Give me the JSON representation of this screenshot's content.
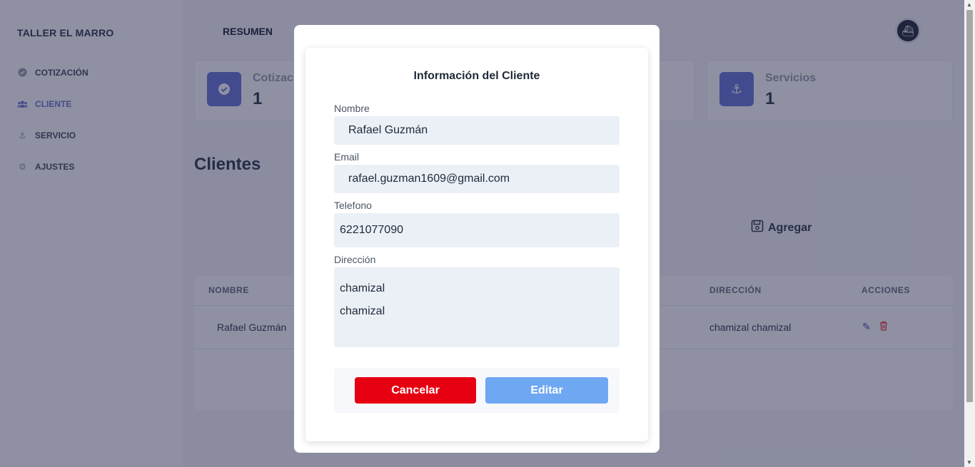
{
  "sidebar": {
    "brand": "TALLER EL MARRO",
    "items": [
      {
        "label": "COTIZACIÓN",
        "icon": "check-circle-icon",
        "active": false
      },
      {
        "label": "CLIENTE",
        "icon": "users-icon",
        "active": true
      },
      {
        "label": "SERVICIO",
        "icon": "anchor-icon",
        "active": false
      },
      {
        "label": "AJUSTES",
        "icon": "gear-icon",
        "active": false
      }
    ]
  },
  "header": {
    "title": "RESUMEN"
  },
  "stats": [
    {
      "label": "Cotizaciones",
      "value": "1",
      "icon": "check-circle-icon"
    },
    {
      "label": "Servicios",
      "value": "1",
      "icon": "anchor-icon"
    }
  ],
  "section": {
    "title": "Clientes",
    "add_label": "Agregar"
  },
  "table": {
    "headers": [
      "NOMBRE",
      "DIRECCIÓN",
      "ACCIONES"
    ],
    "rows": [
      {
        "nombre": "Rafael Guzmán",
        "direccion": "chamizal chamizal"
      }
    ]
  },
  "modal": {
    "title": "Información del Cliente",
    "fields": {
      "nombre_label": "Nombre",
      "nombre_value": "Rafael Guzmán",
      "email_label": "Email",
      "email_value": "rafael.guzman1609@gmail.com",
      "telefono_label": "Telefono",
      "telefono_value": "6221077090",
      "direccion_label": "Dirección",
      "direccion_line1": "chamizal",
      "direccion_line2": "chamizal"
    },
    "cancel_label": "Cancelar",
    "edit_label": "Editar"
  },
  "colors": {
    "accent": "#6b7bd6",
    "cancel": "#e60012",
    "edit": "#6ea7f2",
    "field_bg": "#ebf0f7"
  }
}
